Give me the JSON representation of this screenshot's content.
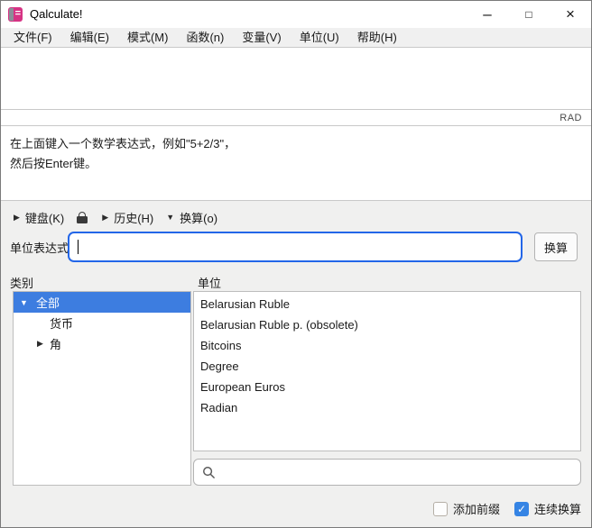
{
  "window": {
    "title": "Qalculate!"
  },
  "icons": {
    "minimize_glyph": "–",
    "maximize_glyph": "□",
    "close_glyph": "×",
    "expander_collapsed": "▶",
    "expander_expanded": "▼",
    "checkmark": "✓"
  },
  "menu": {
    "items": [
      "文件(F)",
      "编辑(E)",
      "模式(M)",
      "函数(n)",
      "变量(V)",
      "单位(U)",
      "帮助(H)"
    ]
  },
  "expression": {
    "value": "",
    "angle_mode": "RAD"
  },
  "help": {
    "line1": "在上面键入一个数学表达式，例如\"5+2/3\"，",
    "line2": "然后按Enter键。"
  },
  "toolbar": {
    "keyboard_label": "键盘(K)",
    "history_label": "历史(H)",
    "conversion_label": "换算(o)"
  },
  "conversion": {
    "label": "单位表达式",
    "input_value": "",
    "convert_button": "换算"
  },
  "categories": {
    "header": "类别",
    "items": [
      {
        "label": "全部",
        "selected": true,
        "expanded": true,
        "level": 0
      },
      {
        "label": "货币",
        "selected": false,
        "level": 1
      },
      {
        "label": "角",
        "selected": false,
        "collapsed": true,
        "level": 1
      }
    ]
  },
  "units": {
    "header": "单位",
    "items": [
      "Belarusian Ruble",
      "Belarusian Ruble p. (obsolete)",
      "Bitcoins",
      "Degree",
      "European Euros",
      "Radian"
    ]
  },
  "search": {
    "value": ""
  },
  "footer": {
    "add_prefix_label": "添加前缀",
    "add_prefix_checked": false,
    "continuous_label": "连续换算",
    "continuous_checked": true
  },
  "colors": {
    "accent_blue": "#3584e4",
    "input_focus_border": "#2366e8",
    "selection_blue": "#3d7de0",
    "icon_pink": "#d63384"
  }
}
